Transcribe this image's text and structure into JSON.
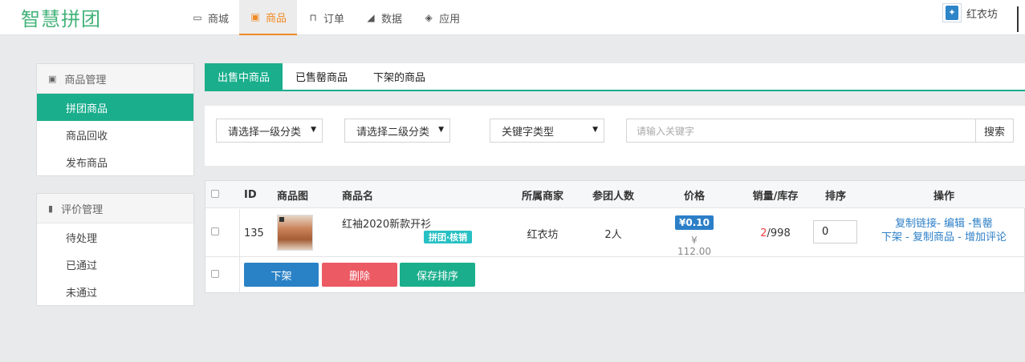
{
  "brand": {
    "logo_text": "智慧拼团",
    "logo_color": "#44b37a",
    "accent": "#1aae8c",
    "nav_active_color": "#f08a24"
  },
  "nav": [
    {
      "label": "商城",
      "icon": "monitor-icon",
      "active": false
    },
    {
      "label": "商品",
      "icon": "gift-icon",
      "active": true
    },
    {
      "label": "订单",
      "icon": "cart-icon",
      "active": false
    },
    {
      "label": "数据",
      "icon": "area-chart-icon",
      "active": false
    },
    {
      "label": "应用",
      "icon": "cubes-icon",
      "active": false
    }
  ],
  "shop": {
    "name": "红衣坊"
  },
  "sidebar": {
    "goods_group": {
      "title": "商品管理",
      "icon": "gift-icon",
      "items": [
        "拼团商品",
        "商品回收",
        "发布商品"
      ]
    },
    "review_group": {
      "title": "评价管理",
      "icon": "bookmark-icon",
      "items": [
        "待处理",
        "已通过",
        "未通过"
      ]
    }
  },
  "tabs": [
    "出售中商品",
    "已售罄商品",
    "下架的商品"
  ],
  "filter": {
    "category1": "请选择一级分类",
    "category2": "请选择二级分类",
    "keyword_type": "关键字类型",
    "keyword_placeholder": "请输入关键字",
    "search_label": "搜索"
  },
  "table": {
    "headers": [
      "ID",
      "商品图",
      "商品名",
      "所属商家",
      "参团人数",
      "价格",
      "销量/库存",
      "排序",
      "操作"
    ],
    "rows": [
      {
        "id": "135",
        "name": "红袖2020新款开衫",
        "type_badge": "拼团·核销",
        "merchant": "红衣坊",
        "group_size": "2人",
        "price": "¥0.10",
        "original_price": "¥ 112.00",
        "sold": "2",
        "stock": "/998",
        "sort": "0",
        "ops": {
          "copy_link": "复制链接",
          "sep1": "-",
          "edit": "编辑",
          "sep2": "-",
          "sold_out": "售罄",
          "offline": "下架",
          "sep3": " - ",
          "copy_goods": "复制商品",
          "sep4": " - ",
          "add_review": "增加评论"
        }
      }
    ]
  },
  "bulk_actions": {
    "offline": {
      "label": "下架",
      "color": "#2a82c6"
    },
    "delete": {
      "label": "删除",
      "color": "#ec5a64"
    },
    "save_sort": {
      "label": "保存排序",
      "color": "#1aae8c"
    }
  }
}
